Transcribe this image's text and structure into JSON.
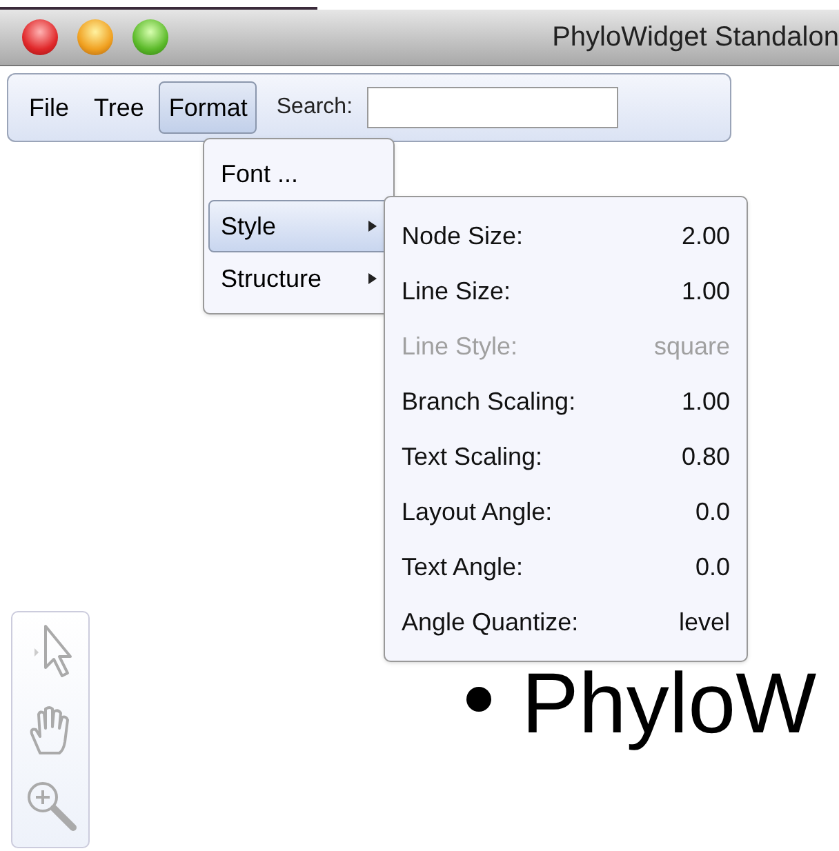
{
  "window": {
    "title": "PhyloWidget Standalon"
  },
  "menubar": [
    {
      "label": "File",
      "selected": false
    },
    {
      "label": "Tree",
      "selected": false
    },
    {
      "label": "Format",
      "selected": true
    }
  ],
  "search": {
    "label": "Search:"
  },
  "format_menu": [
    {
      "label": "Font ...",
      "submenu": false,
      "selected": false
    },
    {
      "label": "Style",
      "submenu": true,
      "selected": true
    },
    {
      "label": "Structure",
      "submenu": true,
      "selected": false
    }
  ],
  "style_menu": [
    {
      "label": "Node Size:",
      "value": "2.00",
      "disabled": false
    },
    {
      "label": "Line Size:",
      "value": "1.00",
      "disabled": false
    },
    {
      "label": "Line Style:",
      "value": "square",
      "disabled": true
    },
    {
      "label": "Branch Scaling:",
      "value": "1.00",
      "disabled": false
    },
    {
      "label": "Text Scaling:",
      "value": "0.80",
      "disabled": false
    },
    {
      "label": "Layout Angle:",
      "value": "0.0",
      "disabled": false
    },
    {
      "label": "Text Angle:",
      "value": "0.0",
      "disabled": false
    },
    {
      "label": "Angle Quantize:",
      "value": "level",
      "disabled": false
    }
  ],
  "canvas": {
    "tree_label": "PhyloW"
  }
}
